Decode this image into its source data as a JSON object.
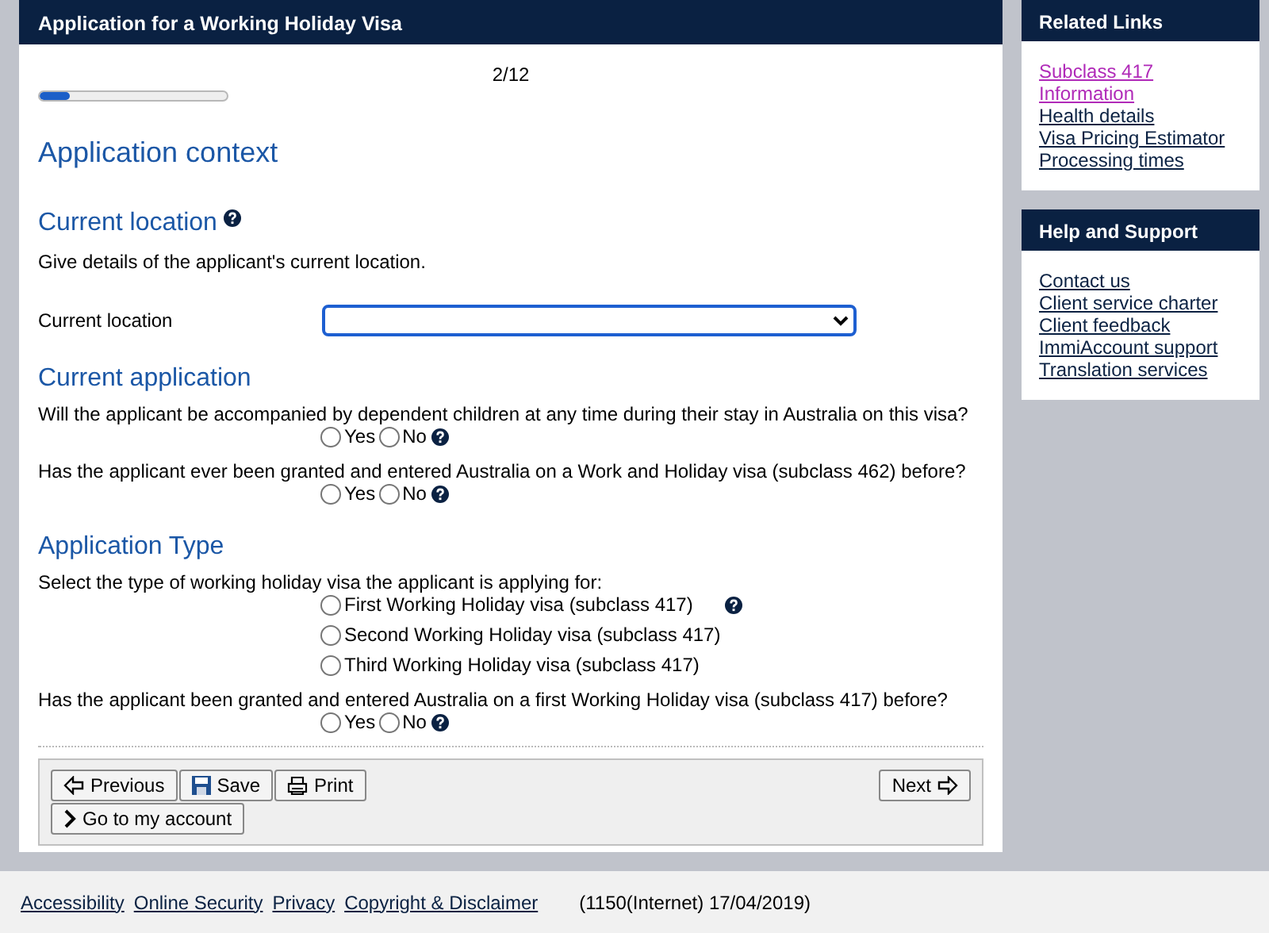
{
  "form": {
    "title": "Application for a Working Holiday Visa",
    "progress": {
      "reading": "2/12",
      "level": 0.16
    },
    "page_heading": "Application context",
    "sections": [
      {
        "heading": "Current location",
        "help": true,
        "items": [
          {
            "kind": "text",
            "text": "Give details of the applicant's current location."
          },
          {
            "kind": "select",
            "label": "Current location"
          }
        ]
      },
      {
        "heading": "Current application",
        "help": false,
        "items": [
          {
            "kind": "radio",
            "question": "Will the applicant be accompanied by dependent children at any time during their stay in Australia on this visa?",
            "inline": true,
            "help": true,
            "options": [
              {
                "label": "Yes",
                "selected": false
              },
              {
                "label": "No",
                "selected": false
              }
            ]
          },
          {
            "kind": "radio",
            "question": "Has the applicant ever been granted and entered Australia on a Work and Holiday visa (subclass 462) before?",
            "inline": true,
            "help": true,
            "options": [
              {
                "label": "Yes",
                "selected": false
              },
              {
                "label": "No",
                "selected": false
              }
            ]
          }
        ]
      },
      {
        "heading": "Application Type",
        "help": false,
        "items": [
          {
            "kind": "radio",
            "question": "Select the type of working holiday visa the applicant is applying for:",
            "inline": false,
            "help": true,
            "options": [
              {
                "label": "First Working Holiday visa (subclass 417)",
                "selected": false
              },
              {
                "label": "Second Working Holiday visa (subclass 417)",
                "selected": false
              },
              {
                "label": "Third Working Holiday visa (subclass 417)",
                "selected": false
              }
            ]
          },
          {
            "kind": "radio",
            "question": "Has the applicant been granted and entered Australia on a first Working Holiday visa (subclass 417) before?",
            "inline": true,
            "help": true,
            "options": [
              {
                "label": "Yes",
                "selected": false
              },
              {
                "label": "No",
                "selected": false
              }
            ]
          }
        ]
      }
    ],
    "buttons": [
      {
        "kind": "previous",
        "label": "Previous"
      },
      {
        "kind": "save",
        "label": "Save"
      },
      {
        "kind": "print",
        "label": "Print"
      },
      {
        "kind": "next",
        "label": "Next"
      },
      {
        "kind": "account",
        "label": "Go to my account"
      }
    ]
  },
  "sidebar": [
    {
      "title": "Related Links",
      "links": [
        {
          "label": "Subclass 417 Information",
          "visited": true
        },
        {
          "label": "Health details",
          "visited": false
        },
        {
          "label": "Visa Pricing Estimator",
          "visited": false
        },
        {
          "label": "Processing times",
          "visited": false
        }
      ]
    },
    {
      "title": "Help and Support",
      "links": [
        {
          "label": "Contact us",
          "visited": false
        },
        {
          "label": "Client service charter",
          "visited": false
        },
        {
          "label": "Client feedback",
          "visited": false
        },
        {
          "label": "ImmiAccount support",
          "visited": false
        },
        {
          "label": "Translation services",
          "visited": false
        }
      ]
    }
  ],
  "footer": {
    "links": [
      "Accessibility",
      "Online Security",
      "Privacy",
      "Copyright & Disclaimer"
    ],
    "text": "(1150(Internet) 17/04/2019)"
  }
}
